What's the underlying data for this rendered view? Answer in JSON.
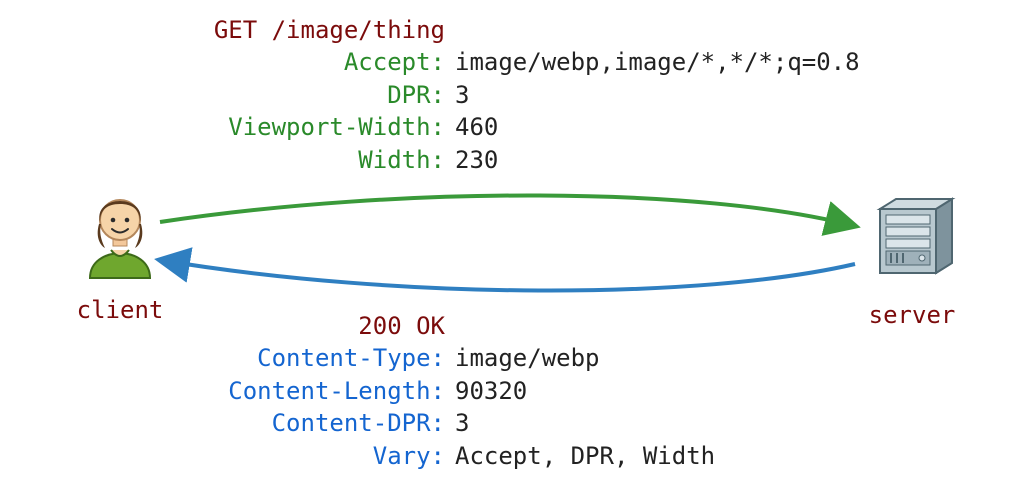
{
  "request": {
    "line": "GET /image/thing",
    "headers": [
      {
        "name": "Accept:",
        "value": "image/webp,image/*,*/*;q=0.8"
      },
      {
        "name": "DPR:",
        "value": "3"
      },
      {
        "name": "Viewport-Width:",
        "value": "460"
      },
      {
        "name": "Width:",
        "value": "230"
      }
    ]
  },
  "response": {
    "line": "200 OK",
    "headers": [
      {
        "name": "Content-Type:",
        "value": "image/webp"
      },
      {
        "name": "Content-Length:",
        "value": "90320"
      },
      {
        "name": "Content-DPR:",
        "value": "3"
      },
      {
        "name": "Vary:",
        "value": "Accept, DPR, Width"
      }
    ]
  },
  "client_label": "client",
  "server_label": "server",
  "colors": {
    "request_arrow": "#3a9a3a",
    "response_arrow": "#2f7fc1",
    "request_header": "#2a8a2a",
    "response_header": "#1465d0",
    "status_line": "#7b0b0b",
    "label": "#7b0b0b"
  }
}
